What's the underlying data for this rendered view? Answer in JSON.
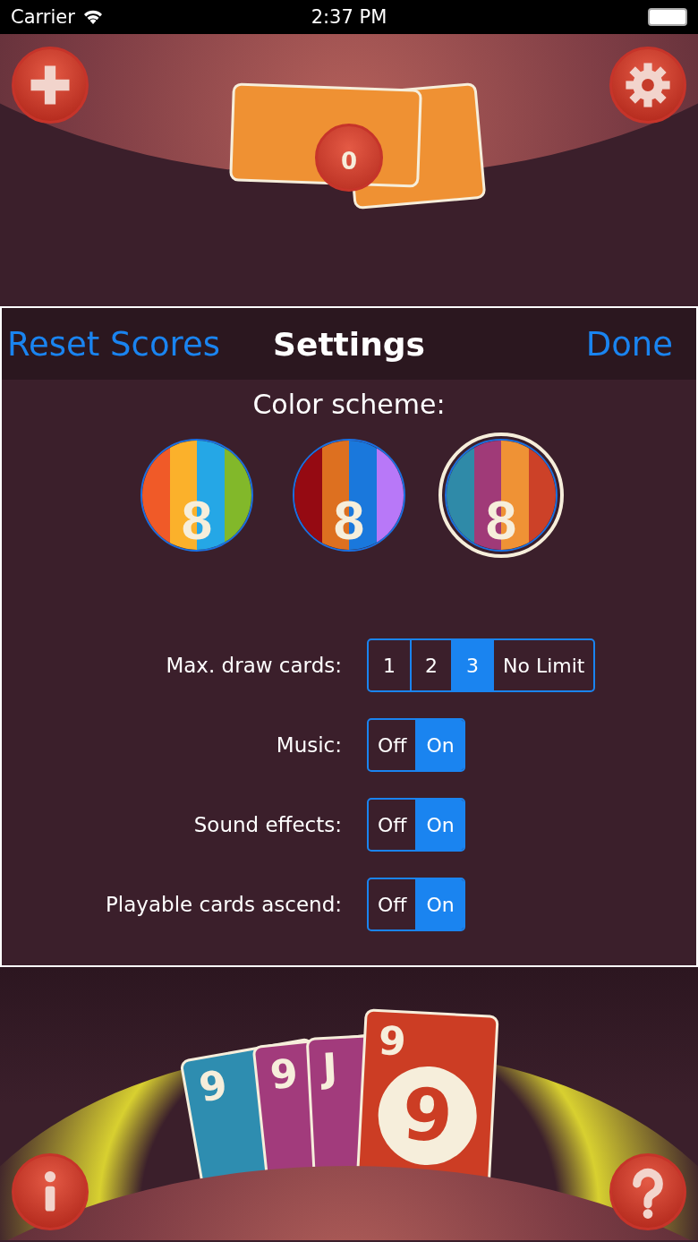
{
  "status_bar": {
    "carrier": "Carrier",
    "time": "2:37 PM"
  },
  "top_area": {
    "pile_count": "0"
  },
  "settings": {
    "left_action": "Reset Scores",
    "title": "Settings",
    "right_action": "Done",
    "color_scheme_label": "Color scheme:",
    "schemes": [
      {
        "selected": false,
        "glyph": "8",
        "stripes": [
          {
            "color": "#f05a28"
          },
          {
            "color": "#fbb12b"
          },
          {
            "color": "#25a7e6"
          },
          {
            "color": "#82b82a"
          }
        ]
      },
      {
        "selected": false,
        "glyph": "8",
        "stripes": [
          {
            "color": "#950a12"
          },
          {
            "color": "#dd7020"
          },
          {
            "color": "#1a78dc"
          },
          {
            "color": "#b878f8"
          }
        ]
      },
      {
        "selected": true,
        "glyph": "8",
        "stripes": [
          {
            "color": "#2f8aa8"
          },
          {
            "color": "#a03a78"
          },
          {
            "color": "#ef9235"
          },
          {
            "color": "#cc4128"
          }
        ]
      }
    ],
    "rows": [
      {
        "label": "Max. draw cards:",
        "options": [
          {
            "label": "1",
            "selected": false
          },
          {
            "label": "2",
            "selected": false
          },
          {
            "label": "3",
            "selected": true
          },
          {
            "label": "No Limit",
            "selected": false
          }
        ]
      },
      {
        "label": "Music:",
        "options": [
          {
            "label": "Off",
            "selected": false
          },
          {
            "label": "On",
            "selected": true
          }
        ]
      },
      {
        "label": "Sound effects:",
        "options": [
          {
            "label": "Off",
            "selected": false
          },
          {
            "label": "On",
            "selected": true
          }
        ]
      },
      {
        "label": "Playable cards ascend:",
        "options": [
          {
            "label": "Off",
            "selected": false
          },
          {
            "label": "On",
            "selected": true
          }
        ]
      }
    ]
  },
  "hand": [
    {
      "color": "#2e8db0",
      "corner": "9"
    },
    {
      "color": "#a23b7c",
      "corner": "9"
    },
    {
      "color": "#a23b7c",
      "corner": "J"
    },
    {
      "color": "#cc3d24",
      "corner": "9",
      "center": "9"
    }
  ]
}
